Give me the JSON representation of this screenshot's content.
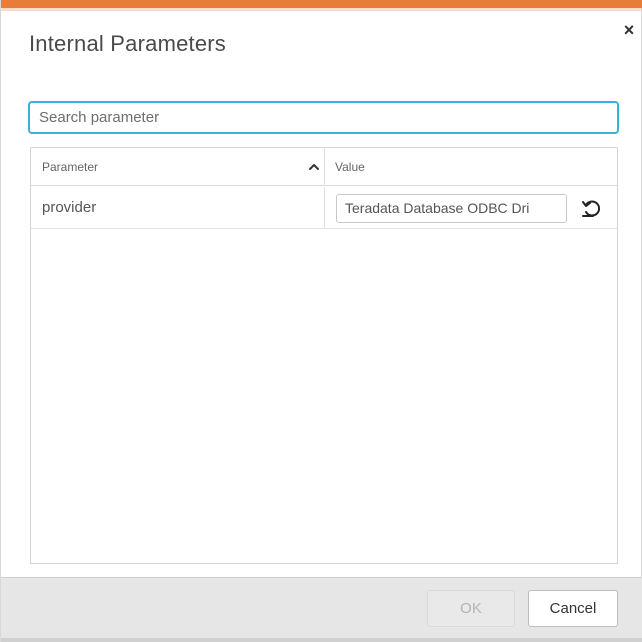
{
  "dialog": {
    "title": "Internal Parameters",
    "close_symbol": "×",
    "accent_color": "#e87d3a"
  },
  "search": {
    "placeholder": "Search parameter",
    "value": ""
  },
  "table": {
    "columns": [
      {
        "label": "Parameter",
        "sort": "ascending",
        "sort_icon": "chevron-up-icon"
      },
      {
        "label": "Value"
      }
    ],
    "rows": [
      {
        "parameter": "provider",
        "value": "Teradata Database ODBC Dri",
        "action_icon": "reset-icon"
      }
    ]
  },
  "footer": {
    "ok_label": "OK",
    "ok_enabled": false,
    "cancel_label": "Cancel"
  }
}
